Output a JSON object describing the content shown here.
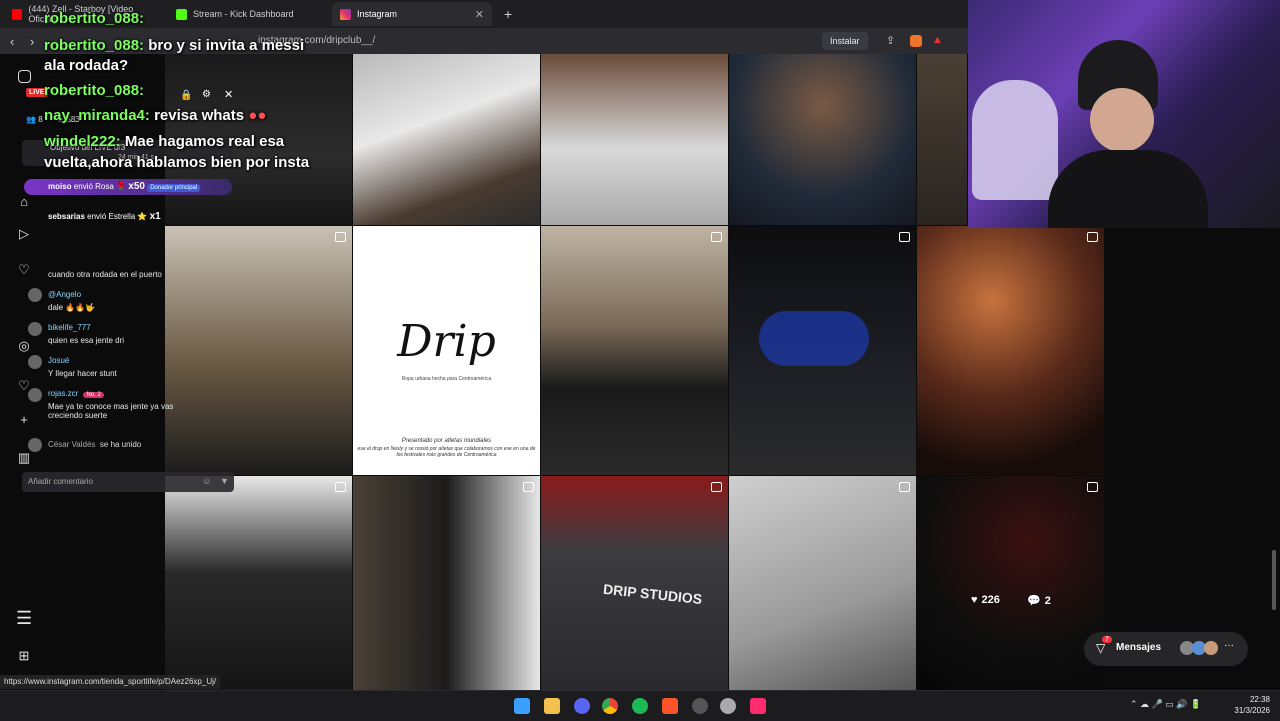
{
  "browser": {
    "tabs": [
      {
        "label": "(444) Zell - Starboy [Video Oficial]"
      },
      {
        "label": "Stream - Kick Dashboard"
      },
      {
        "label": "Instagram"
      }
    ],
    "url": "instagram.com/dripclub__/",
    "install_label": "Instalar",
    "status_url": "https://www.instagram.com/tienda_sportlife/p/DAez26xp_Uj/"
  },
  "overlay_chat": [
    {
      "user": "robertito_088:",
      "text": ""
    },
    {
      "user": "robertito_088:",
      "text": "bro y si invita a messi"
    },
    {
      "user": "",
      "text": "ala rodada?"
    },
    {
      "user": "robertito_088:",
      "text": ""
    },
    {
      "user": "nay_miranda4:",
      "text": "revisa whats"
    },
    {
      "user": "windel222:",
      "text": "Mae hagamos real esa"
    },
    {
      "user": "",
      "text": "vuelta,ahora hablamos bien por insta"
    }
  ],
  "kick": {
    "live_badge": "LIVE",
    "viewers": "8",
    "followers": "583",
    "goal": "Objetivo del LIVE 0/3",
    "uptime": "24 min 41 s",
    "gift1_user": "moiso",
    "gift1_text": "envió Rosa",
    "gift1_count": "x50",
    "gift1_badge": "Donador principal",
    "gift2_user": "sebsarias",
    "gift2_text": "envió Estrella",
    "gift2_count": "x1",
    "comments": [
      {
        "user": "",
        "text": "cuando otra rodada en el puerto"
      },
      {
        "user": "@Angelo",
        "text": "dale 🔥🔥🤟"
      },
      {
        "user": "bikelife_777",
        "text": "quien es esa jente dri"
      },
      {
        "user": "Josué",
        "text": "Y llegar hacer stunt"
      },
      {
        "user": "rojas.zcr",
        "text": "Mae ya te conoce mas jente ya vas creciendo suerte",
        "badge": "No. 2"
      }
    ],
    "joined_user": "César Valdés",
    "joined_text": "se ha unido",
    "comment_placeholder": "Añadir comentario"
  },
  "post": {
    "brand": "Drip",
    "tagline": "Ropa urbana hecha para Centroamérica",
    "presented": "Presentado por atletas mundiales",
    "caption": "ese el drop en Nexly y se rossió por atletas que colaboramos con ese en una de los festivales más grandes de Centroamérica"
  },
  "post_stats": {
    "likes": "226",
    "comments": "2"
  },
  "shirt_text": "DRIP STUDIOS",
  "messages": {
    "label": "Mensajes",
    "badge": "7"
  },
  "clock": {
    "time": "22:38",
    "date": "31/3/2026"
  },
  "colors": {
    "accent_green": "#7cff5e",
    "kick_live": "#e02a2a",
    "instagram_bg": "#0b0b0c"
  }
}
